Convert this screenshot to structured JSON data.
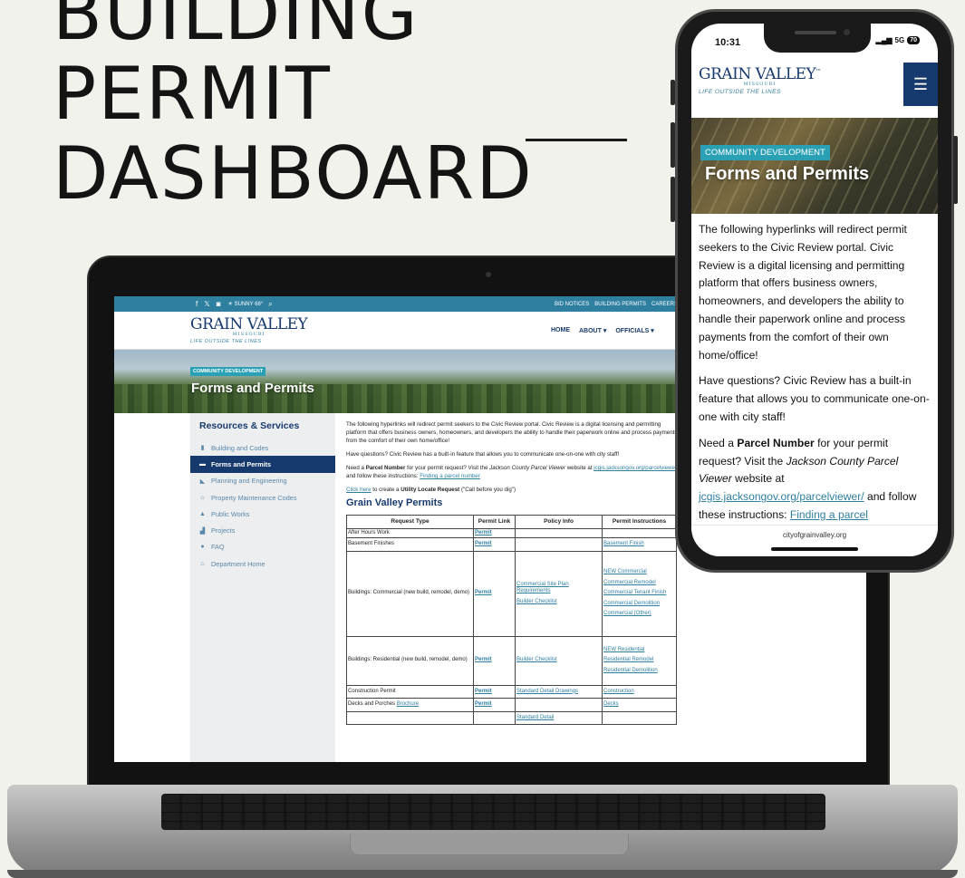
{
  "headline": {
    "line1": "BUILDING",
    "line2": "PERMIT",
    "line3": "DASHBOARD"
  },
  "desktop": {
    "topbar": {
      "social_icons": [
        "facebook-icon",
        "x-icon",
        "instagram-icon"
      ],
      "weather": "☀ SUNNY 68°",
      "links": [
        "BID NOTICES",
        "BUILDING PERMITS",
        "CAREERS"
      ]
    },
    "logo": {
      "name": "GRAIN VALLEY",
      "state": "MISSOURI",
      "tagline": "LIFE OUTSIDE THE LINES"
    },
    "nav": {
      "home": "HOME",
      "about": "ABOUT ▾",
      "officials": "OFFICIALS ▾"
    },
    "hero": {
      "badge": "COMMUNITY DEVELOPMENT",
      "title": "Forms and Permits"
    },
    "sidebar": {
      "heading": "Resources & Services",
      "items": [
        {
          "label": "Building and Codes",
          "icon": "building-icon"
        },
        {
          "label": "Forms and Permits",
          "icon": "forms-icon"
        },
        {
          "label": "Planning and Engineering",
          "icon": "ruler-icon"
        },
        {
          "label": "Property Maintenance Codes",
          "icon": "home-icon"
        },
        {
          "label": "Public Works",
          "icon": "cone-icon"
        },
        {
          "label": "Projects",
          "icon": "projects-icon"
        },
        {
          "label": "FAQ",
          "icon": "faq-icon"
        },
        {
          "label": "Department Home",
          "icon": "department-home-icon"
        }
      ]
    },
    "main": {
      "intro": "The following hyperlinks will redirect permit seekers to the Civic Review portal. Civic Review is a digital licensing and permitting platform that offers business owners, homeowners, and developers the ability to handle their paperwork online and process payments from the comfort of their own home/office!",
      "questions": "Have questions? Civic Review has a built-in feature that allows you to communicate one-on-one with city staff!",
      "parcel_pre": "Need a",
      "parcel_bold": "Parcel Number",
      "parcel_mid": "for your permit request? Visit the",
      "parcel_italic": "Jackson County Parcel Viewer",
      "parcel_mid2": "website at",
      "parcel_link": "jcgis.jacksongov.org/parcelviewer/",
      "parcel_mid3": "and follow these instructions:",
      "parcel_link2": "Finding a parcel number",
      "utility_link": "Click here",
      "utility_mid": "to create a",
      "utility_bold": "Utility Locate Request",
      "utility_end": "(\"Call before you dig\")",
      "permits_title": "Grain Valley Permits"
    },
    "table": {
      "headers": [
        "Request Type",
        "Permit Link",
        "Policy Info",
        "Permit Instructions"
      ],
      "rows": {
        "r1": {
          "type": "After Hours Work",
          "link": "Permit"
        },
        "r2": {
          "type": "Basement Finishes",
          "link": "Permit",
          "instr": [
            "Basement Finish"
          ]
        },
        "r3": {
          "type": "Buildings: Commercial (new build, remodel, demo)",
          "link": "Permit",
          "policy": [
            "Commercial Site Plan Requirements",
            "Builder Checklist"
          ],
          "instr": [
            "NEW Commercial",
            "Commercial Remodel",
            "Commercial Tenant Finish",
            "Commercial Demolition",
            "Commercial (Other)"
          ]
        },
        "r4": {
          "type": "Buildings: Residential (new build, remodel, demo)",
          "link": "Permit",
          "policy": [
            "Builder Checklist"
          ],
          "instr": [
            "NEW Residential",
            "Residential Remodel",
            "Residential Demolition"
          ]
        },
        "r5": {
          "type": "Construction Permit",
          "link": "Permit",
          "policy": [
            "Standard Detail Drawings"
          ],
          "instr": [
            "Construction"
          ]
        },
        "r6": {
          "type": "Decks and Porches",
          "brochure": "Brochure",
          "link": "Permit",
          "instr": [
            "Decks"
          ]
        },
        "r7": {
          "policy": [
            "Standard Detail"
          ]
        }
      }
    }
  },
  "phone": {
    "time": "10:31",
    "signal": "5G",
    "battery": "70",
    "logo": {
      "name": "GRAIN VALLEY",
      "tm": "™",
      "state": "MISSOURI",
      "tagline": "LIFE OUTSIDE THE LINES"
    },
    "menu_icon": "☰",
    "hero": {
      "badge": "COMMUNITY DEVELOPMENT",
      "title": "Forms and Permits"
    },
    "intro": "The following hyperlinks will redirect permit seekers to the Civic Review portal.  Civic Review is a digital licensing and permitting platform that offers business owners, homeowners, and developers the ability to handle their paperwork online and process payments from the comfort of their own home/office!",
    "questions": "Have questions? Civic Review has a built-in feature that allows you to communicate one-on-one with city staff!",
    "parcel_pre": "Need a",
    "parcel_bold": "Parcel Number",
    "parcel_mid": "for your permit request?  Visit the",
    "parcel_italic": "Jackson County Parcel Viewer",
    "parcel_mid2": "website at",
    "parcel_link": "jcgis.jacksongov.org/parcelviewer/",
    "parcel_mid3": "and follow these instructions:",
    "parcel_link2": "Finding a parcel",
    "footer_url": "cityofgrainvalley.org"
  }
}
